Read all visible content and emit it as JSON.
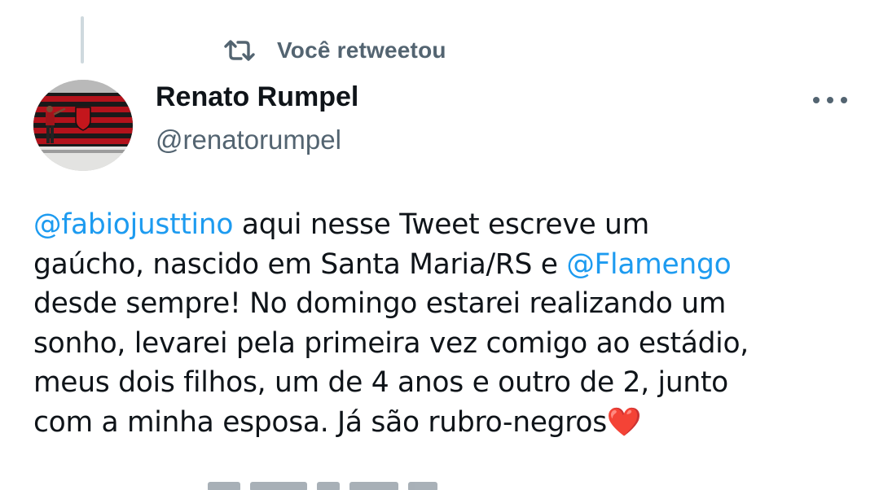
{
  "retweet_context": {
    "icon": "retweet-icon",
    "label": "Você retweetou"
  },
  "author": {
    "name": "Renato Rumpel",
    "handle": "@renatorumpel",
    "avatar_icon": "avatar-photo"
  },
  "more_menu": {
    "icon": "more-horizontal-icon"
  },
  "tweet": {
    "lines": [
      [
        "@fabiojusttino",
        " aqui nesse Tweet escreve um"
      ],
      [
        "gaúcho, nascido em Santa Maria/RS e ",
        "@Flamengo"
      ],
      [
        "desde sempre! No domingo estarei realizando um"
      ],
      [
        "sonho, levarei pela primeira vez comigo ao estádio,"
      ],
      [
        "meus dois filhos, um de 4 anos e outro de 2, junto"
      ],
      [
        "com a minha esposa. Já são rubro-negros",
        "❤️"
      ]
    ]
  },
  "colors": {
    "mention": "#1d9bf0",
    "secondary_text": "#536471",
    "primary_text": "#0f1419",
    "heart": "#e0243a"
  }
}
